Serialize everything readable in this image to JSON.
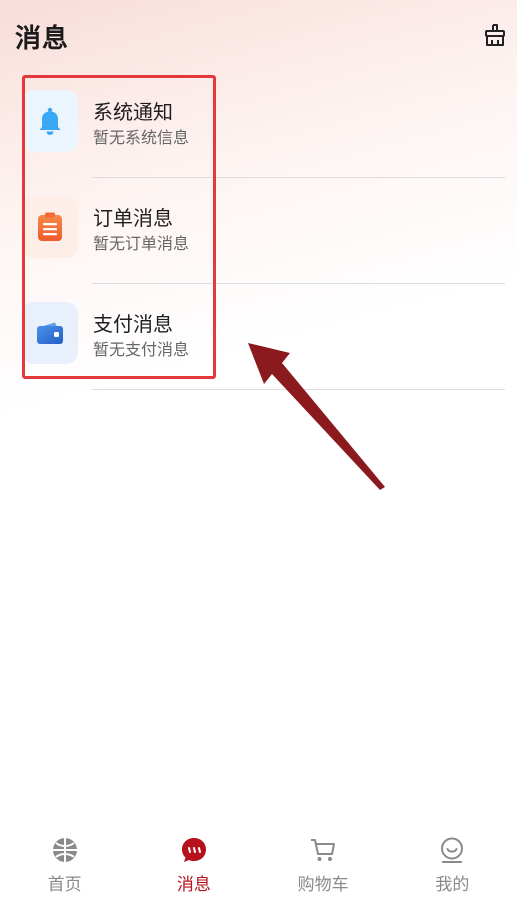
{
  "header": {
    "title": "消息",
    "clean_icon": "broom-icon"
  },
  "messages": [
    {
      "title": "系统通知",
      "subtitle": "暂无系统信息",
      "icon": "bell-icon",
      "icon_color": "#3aa8f5",
      "icon_bg": "#eaf5fd"
    },
    {
      "title": "订单消息",
      "subtitle": "暂无订单消息",
      "icon": "clipboard-icon",
      "icon_color": "#f06a35",
      "icon_bg": "#fdeee8"
    },
    {
      "title": "支付消息",
      "subtitle": "暂无支付消息",
      "icon": "wallet-icon",
      "icon_color": "#2f74d8",
      "icon_bg": "#e8f0fb"
    }
  ],
  "tabs": [
    {
      "label": "首页",
      "icon": "home-icon",
      "active": false
    },
    {
      "label": "消息",
      "icon": "message-icon",
      "active": true
    },
    {
      "label": "购物车",
      "icon": "cart-icon",
      "active": false
    },
    {
      "label": "我的",
      "icon": "profile-icon",
      "active": false
    }
  ],
  "colors": {
    "accent": "#b5121b",
    "highlight_box": "#e5383b",
    "arrow": "#8b1a1f",
    "tab_inactive": "#8a8a8a"
  }
}
